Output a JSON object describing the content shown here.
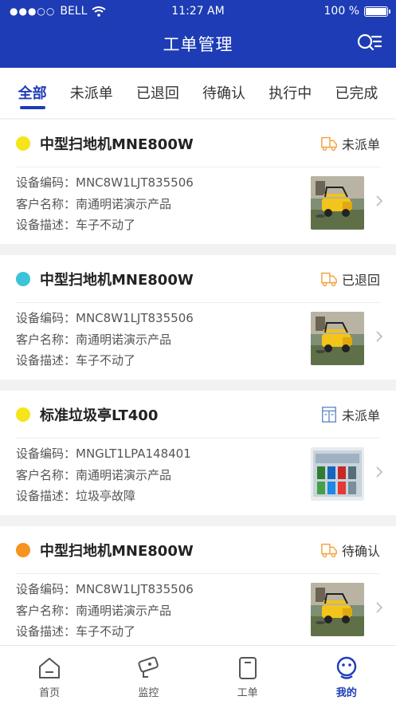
{
  "status_bar": {
    "carrier": "BELL",
    "time": "11:27 AM",
    "battery": "100 %"
  },
  "header": {
    "title": "工单管理"
  },
  "tabs": [
    {
      "label": "全部",
      "active": true
    },
    {
      "label": "未派单",
      "active": false
    },
    {
      "label": "已退回",
      "active": false
    },
    {
      "label": "待确认",
      "active": false
    },
    {
      "label": "执行中",
      "active": false
    },
    {
      "label": "已完成",
      "active": false
    }
  ],
  "field_labels": {
    "code": "设备编码：",
    "customer": "客户名称：",
    "desc": "设备描述："
  },
  "orders": [
    {
      "title": "中型扫地机MNE800W",
      "dot_color": "#f5e51a",
      "status": "未派单",
      "status_icon": "truck-icon",
      "code": "MNC8W1LJT835506",
      "customer": "南通明诺演示产品",
      "desc": "车子不动了",
      "thumb": "sweeper-image"
    },
    {
      "title": "中型扫地机MNE800W",
      "dot_color": "#3cc3d8",
      "status": "已退回",
      "status_icon": "truck-icon",
      "code": "MNC8W1LJT835506",
      "customer": "南通明诺演示产品",
      "desc": "车子不动了",
      "thumb": "sweeper-image"
    },
    {
      "title": "标准垃圾亭LT400",
      "dot_color": "#f5e51a",
      "status": "未派单",
      "status_icon": "kiosk-icon",
      "code": "MNGLT1LPA148401",
      "customer": "南通明诺演示产品",
      "desc": "垃圾亭故障",
      "thumb": "garbage-kiosk-image"
    },
    {
      "title": "中型扫地机MNE800W",
      "dot_color": "#f7931e",
      "status": "待确认",
      "status_icon": "truck-icon",
      "code": "MNC8W1LJT835506",
      "customer": "南通明诺演示产品",
      "desc": "车子不动了",
      "thumb": "sweeper-image"
    }
  ],
  "tabbar": [
    {
      "label": "首页",
      "icon": "home-icon",
      "active": false
    },
    {
      "label": "监控",
      "icon": "camera-icon",
      "active": false
    },
    {
      "label": "工单",
      "icon": "workorder-icon",
      "active": false
    },
    {
      "label": "我的",
      "icon": "profile-icon",
      "active": true
    }
  ],
  "colors": {
    "brand": "#1d3cb5",
    "status_icon": "#f4a340",
    "kiosk_icon": "#6d8fc9"
  }
}
